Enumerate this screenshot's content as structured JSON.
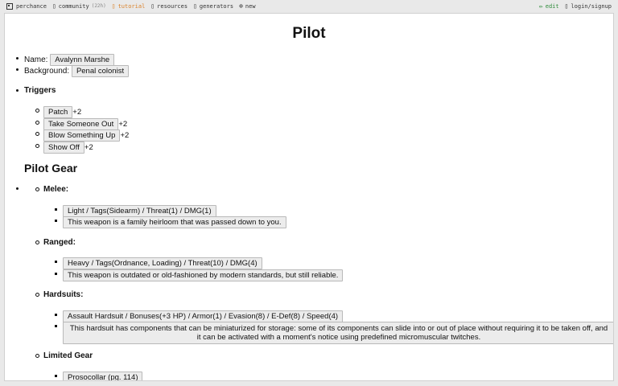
{
  "nav": {
    "site": "perchance",
    "community": "community",
    "community_badge": "(22h)",
    "tutorial": "tutorial",
    "resources": "resources",
    "generators": "generators",
    "new": "new",
    "edit": "edit",
    "login": "login/signup"
  },
  "page": {
    "title": "Pilot",
    "name_label": "Name:",
    "name_value": "Avalynn Marshe",
    "background_label": "Background:",
    "background_value": "Penal colonist",
    "triggers_heading": "Triggers",
    "triggers": [
      {
        "name": "Patch",
        "mod": "+2"
      },
      {
        "name": "Take Someone Out",
        "mod": "+2"
      },
      {
        "name": "Blow Something Up",
        "mod": "+2"
      },
      {
        "name": "Show Off",
        "mod": "+2"
      }
    ],
    "gear_heading": "Pilot Gear",
    "melee_label": "Melee:",
    "melee_stats": "Light / Tags(Sidearm) / Threat(1) / DMG(1)",
    "melee_desc": "This weapon is a family heirloom that was passed down to you.",
    "ranged_label": "Ranged:",
    "ranged_stats": "Heavy / Tags(Ordnance, Loading) / Threat(10) / DMG(4)",
    "ranged_desc": "This weapon is outdated or old-fashioned by modern standards, but still reliable.",
    "hardsuits_label": "Hardsuits:",
    "hardsuit_stats": "Assault Hardsuit / Bonuses(+3 HP) / Armor(1) / Evasion(8) / E-Def(8) / Speed(4)",
    "hardsuit_desc": "This hardsuit has components that can be miniaturized for storage: some of its components can slide into or out of place without requiring it to be taken off, and it can be activated with a moment's notice using predefined micromuscular twitches.",
    "limited_label": "Limited Gear",
    "limited_item": "Prosocollar (pg. 114)"
  }
}
